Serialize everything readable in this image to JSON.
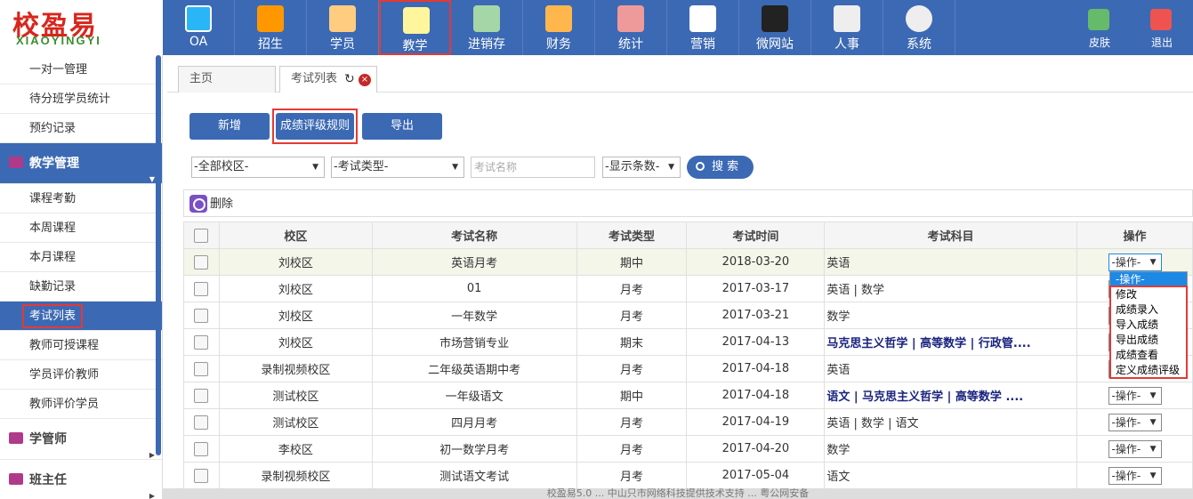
{
  "logo": {
    "cn": "校盈易",
    "en": "XIAOYINGYI"
  },
  "nav": [
    {
      "name": "oa",
      "label": "OA",
      "icon": "oa-icon"
    },
    {
      "name": "enroll",
      "label": "招生",
      "icon": "enroll-icon"
    },
    {
      "name": "student",
      "label": "学员",
      "icon": "student-icon"
    },
    {
      "name": "teaching",
      "label": "教学",
      "icon": "teaching-icon"
    },
    {
      "name": "inventory",
      "label": "进销存",
      "icon": "inventory-icon"
    },
    {
      "name": "finance",
      "label": "财务",
      "icon": "finance-icon"
    },
    {
      "name": "stats",
      "label": "统计",
      "icon": "stats-icon"
    },
    {
      "name": "marketing",
      "label": "营销",
      "icon": "marketing-icon"
    },
    {
      "name": "microsite",
      "label": "微网站",
      "icon": "monitor-icon"
    },
    {
      "name": "hr",
      "label": "人事",
      "icon": "hr-icon"
    },
    {
      "name": "system",
      "label": "系统",
      "icon": "gear-icon"
    }
  ],
  "nav_right": [
    {
      "name": "skin",
      "label": "皮肤"
    },
    {
      "name": "logout",
      "label": "退出"
    }
  ],
  "sidebar": {
    "top_items": [
      "一对一管理",
      "待分班学员统计",
      "预约记录"
    ],
    "group1": "教学管理",
    "group1_items": [
      "课程考勤",
      "本周课程",
      "本月课程",
      "缺勤记录",
      "考试列表",
      "教师可授课程",
      "学员评价教师",
      "教师评价学员"
    ],
    "group2": "学管师",
    "group3": "班主任"
  },
  "tabs": {
    "home": "主页",
    "current": "考试列表"
  },
  "toolbar": {
    "add": "新增",
    "rule": "成绩评级规则",
    "export": "导出"
  },
  "filters": {
    "campus": "-全部校区-",
    "type": "-考试类型-",
    "name_placeholder": "考试名称",
    "count": "-显示条数-",
    "search": "搜 索"
  },
  "delete_label": "删除",
  "table": {
    "headers": [
      "校区",
      "考试名称",
      "考试类型",
      "考试时间",
      "考试科目",
      "操作"
    ],
    "rows": [
      {
        "campus": "刘校区",
        "name": "英语月考",
        "type": "期中",
        "date": "2018-03-20",
        "subjects": "英语",
        "blue": false
      },
      {
        "campus": "刘校区",
        "name": "01",
        "type": "月考",
        "date": "2017-03-17",
        "subjects": "英语 | 数学",
        "blue": false
      },
      {
        "campus": "刘校区",
        "name": "一年数学",
        "type": "月考",
        "date": "2017-03-21",
        "subjects": "数学",
        "blue": false
      },
      {
        "campus": "刘校区",
        "name": "市场营销专业",
        "type": "期末",
        "date": "2017-04-13",
        "subjects": "马克思主义哲学 | 高等数学 | 行政管....",
        "blue": true
      },
      {
        "campus": "录制视频校区",
        "name": "二年级英语期中考",
        "type": "月考",
        "date": "2017-04-18",
        "subjects": "英语",
        "blue": false
      },
      {
        "campus": "测试校区",
        "name": "一年级语文",
        "type": "期中",
        "date": "2017-04-18",
        "subjects": "语文 | 马克思主义哲学 | 高等数学 ....",
        "blue": true
      },
      {
        "campus": "测试校区",
        "name": "四月月考",
        "type": "月考",
        "date": "2017-04-19",
        "subjects": "英语 | 数学 | 语文",
        "blue": false
      },
      {
        "campus": "李校区",
        "name": "初一数学月考",
        "type": "月考",
        "date": "2017-04-20",
        "subjects": "数学",
        "blue": false
      },
      {
        "campus": "录制视频校区",
        "name": "测试语文考试",
        "type": "月考",
        "date": "2017-05-04",
        "subjects": "语文",
        "blue": false
      }
    ],
    "op_label": "-操作-"
  },
  "dropdown": [
    "-操作-",
    "修改",
    "成绩录入",
    "导入成绩",
    "导出成绩",
    "成绩查看",
    "定义成绩评级"
  ],
  "footer": "校盈易5.0 ... 中山只市网络科技提供技术支持 ... 粤公网安备"
}
